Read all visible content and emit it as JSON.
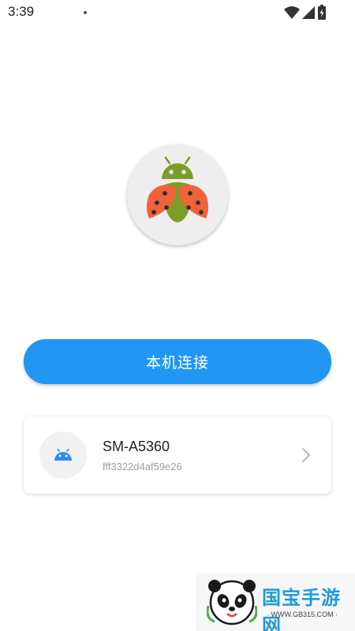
{
  "status_bar": {
    "time": "3:39",
    "icons": [
      "wifi-icon",
      "signal-icon",
      "battery-icon"
    ]
  },
  "app": {
    "logo": "ladybug-android-logo"
  },
  "actions": {
    "connect_local_label": "本机连接"
  },
  "device": {
    "icon": "android-icon",
    "name": "SM-A5360",
    "serial": "fff3322d4af59e26"
  },
  "watermark": {
    "title": "国宝手游网",
    "url": "· WWW.GB315.COM ·"
  },
  "colors": {
    "accent": "#2196f3",
    "android_green": "#7f9b2a",
    "ladybug_red": "#f0623a",
    "device_icon_blue": "#2f8df4"
  }
}
